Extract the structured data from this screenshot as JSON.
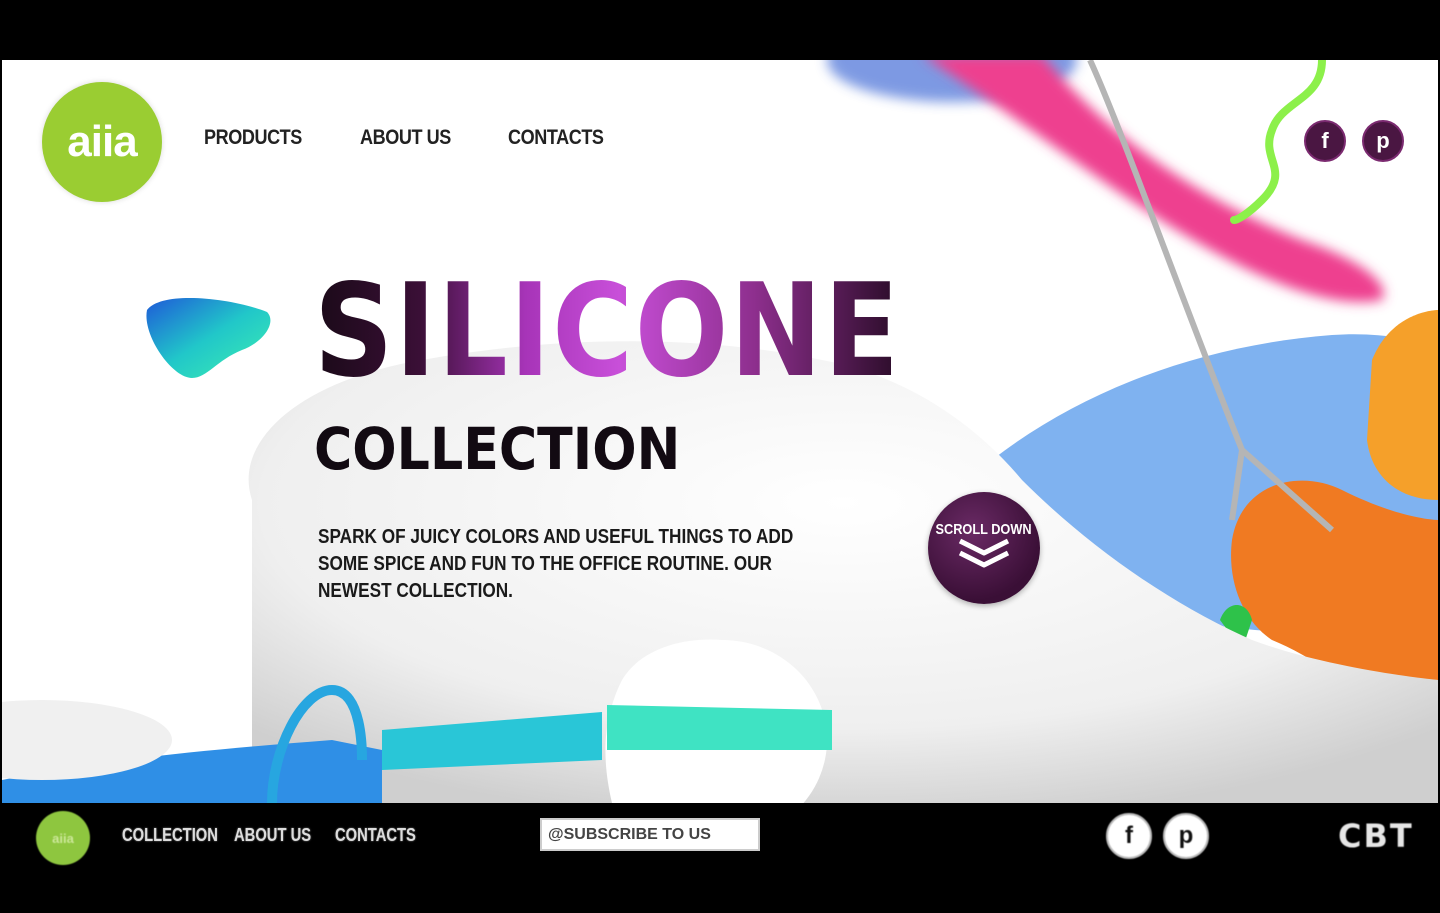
{
  "brand": {
    "logo_text": "aiia"
  },
  "nav": {
    "items": [
      {
        "label": "PRODUCTS"
      },
      {
        "label": "ABOUT US"
      },
      {
        "label": "CONTACTS"
      }
    ]
  },
  "social": {
    "facebook_glyph": "f",
    "pinterest_glyph": "p"
  },
  "hero": {
    "title": "SILICONE",
    "subtitle": "COLLECTION",
    "description": "SPARK OF JUICY COLORS AND USEFUL THINGS TO ADD SOME SPICE AND FUN TO THE OFFICE ROUTINE. OUR NEWEST COLLECTION.",
    "scroll_label": "SCROLL DOWN"
  },
  "footer": {
    "logo_text": "aiia",
    "nav": [
      {
        "label": "COLLECTION"
      },
      {
        "label": "ABOUT US"
      },
      {
        "label": "CONTACTS"
      }
    ],
    "subscribe_placeholder": "@SUBSCRIBE TO US",
    "watermark": "CBT"
  },
  "colors": {
    "accent_green": "#9acd32",
    "title_purple": "#c84fd9",
    "dark_plum": "#3a0f36",
    "pink": "#ee3f8f",
    "blue": "#7fb2f0",
    "orange": "#f07a22",
    "teal": "#3fe3c3"
  },
  "icons": [
    "facebook-icon",
    "pinterest-icon",
    "chevron-double-down-icon"
  ]
}
